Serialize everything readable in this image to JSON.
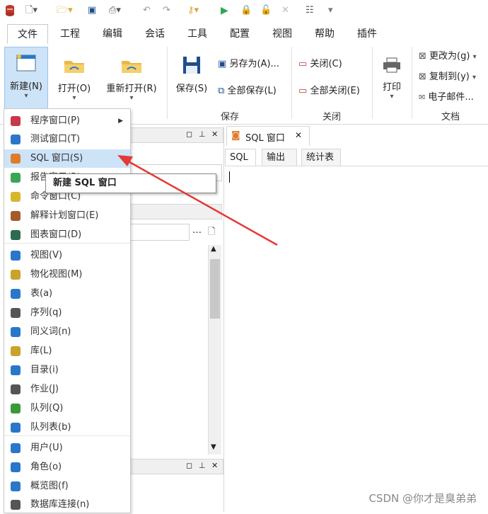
{
  "quick_access": {
    "icons": [
      "database-icon",
      "new-file-icon",
      "open-folder-icon",
      "save-icon",
      "print-icon",
      "undo-icon",
      "redo-icon",
      "key-icon",
      "run-icon",
      "lock-icon",
      "lock-open-icon",
      "pin-icon",
      "settings-icon",
      "customize-icon"
    ]
  },
  "menubar": {
    "items": [
      "文件",
      "工程",
      "编辑",
      "会话",
      "工具",
      "配置",
      "视图",
      "帮助",
      "插件"
    ],
    "active": "文件"
  },
  "ribbon": {
    "new_label": "新建(N)",
    "open_label": "打开(O)",
    "reopen_label": "重新打开(R)",
    "save_label": "保存(S)",
    "save_as_label": "另存为(A)...",
    "save_all_label": "全部保存(L)",
    "group_save": "保存",
    "close_label": "关闭(C)",
    "close_all_label": "全部关闭(E)",
    "group_close": "关闭",
    "print_label": "打印",
    "change_to_label": "更改为(g)",
    "copy_to_label": "复制到(y)",
    "email_label": "电子邮件...",
    "group_doc": "文档"
  },
  "dropdown": {
    "items": [
      {
        "label": "程序窗口(P)",
        "icon": "program-window-icon",
        "color": "#c8374a",
        "submenu": true
      },
      {
        "label": "测试窗口(T)",
        "icon": "test-window-icon",
        "color": "#2a77c9"
      },
      {
        "label": "SQL 窗口(S)",
        "icon": "sql-window-icon",
        "color": "#e07b2c",
        "highlighted": true
      },
      {
        "label": "报告窗口(R)",
        "icon": "report-window-icon",
        "color": "#3aa655"
      },
      {
        "label": "命令窗口(C)",
        "icon": "command-window-icon",
        "color": "#d6b62c"
      },
      {
        "label": "解释计划窗口(E)",
        "icon": "explain-plan-icon",
        "color": "#a45a2a"
      },
      {
        "label": "图表窗口(D)",
        "icon": "diagram-window-icon",
        "color": "#2e6a4f"
      },
      {
        "label": "视图(V)",
        "icon": "view-icon",
        "color": "#2a77c9"
      },
      {
        "label": "物化视图(M)",
        "icon": "materialized-view-icon",
        "color": "#c9a32a"
      },
      {
        "label": "表(a)",
        "icon": "table-icon",
        "color": "#2a77c9"
      },
      {
        "label": "序列(q)",
        "icon": "sequence-icon",
        "color": "#555555"
      },
      {
        "label": "同义词(n)",
        "icon": "synonym-icon",
        "color": "#2a77c9"
      },
      {
        "label": "库(L)",
        "icon": "library-icon",
        "color": "#c9a32a"
      },
      {
        "label": "目录(i)",
        "icon": "directory-icon",
        "color": "#2a77c9"
      },
      {
        "label": "作业(J)",
        "icon": "job-icon",
        "color": "#555555"
      },
      {
        "label": "队列(Q)",
        "icon": "queue-icon",
        "color": "#3a9a3a"
      },
      {
        "label": "队列表(b)",
        "icon": "queue-table-icon",
        "color": "#2a77c9"
      },
      {
        "label": "用户(U)",
        "icon": "user-icon",
        "color": "#2a77c9"
      },
      {
        "label": "角色(o)",
        "icon": "role-icon",
        "color": "#2a77c9"
      },
      {
        "label": "概览图(f)",
        "icon": "overview-icon",
        "color": "#2a77c9"
      },
      {
        "label": "数据库连接(n)",
        "icon": "db-link-icon",
        "color": "#555555"
      }
    ]
  },
  "tooltip": {
    "text": "新建 SQL 窗口"
  },
  "editor": {
    "tab_title": "SQL 窗口",
    "subtabs": [
      "SQL",
      "输出",
      "统计表"
    ]
  },
  "watermark": "CSDN @你才是臭弟弟"
}
